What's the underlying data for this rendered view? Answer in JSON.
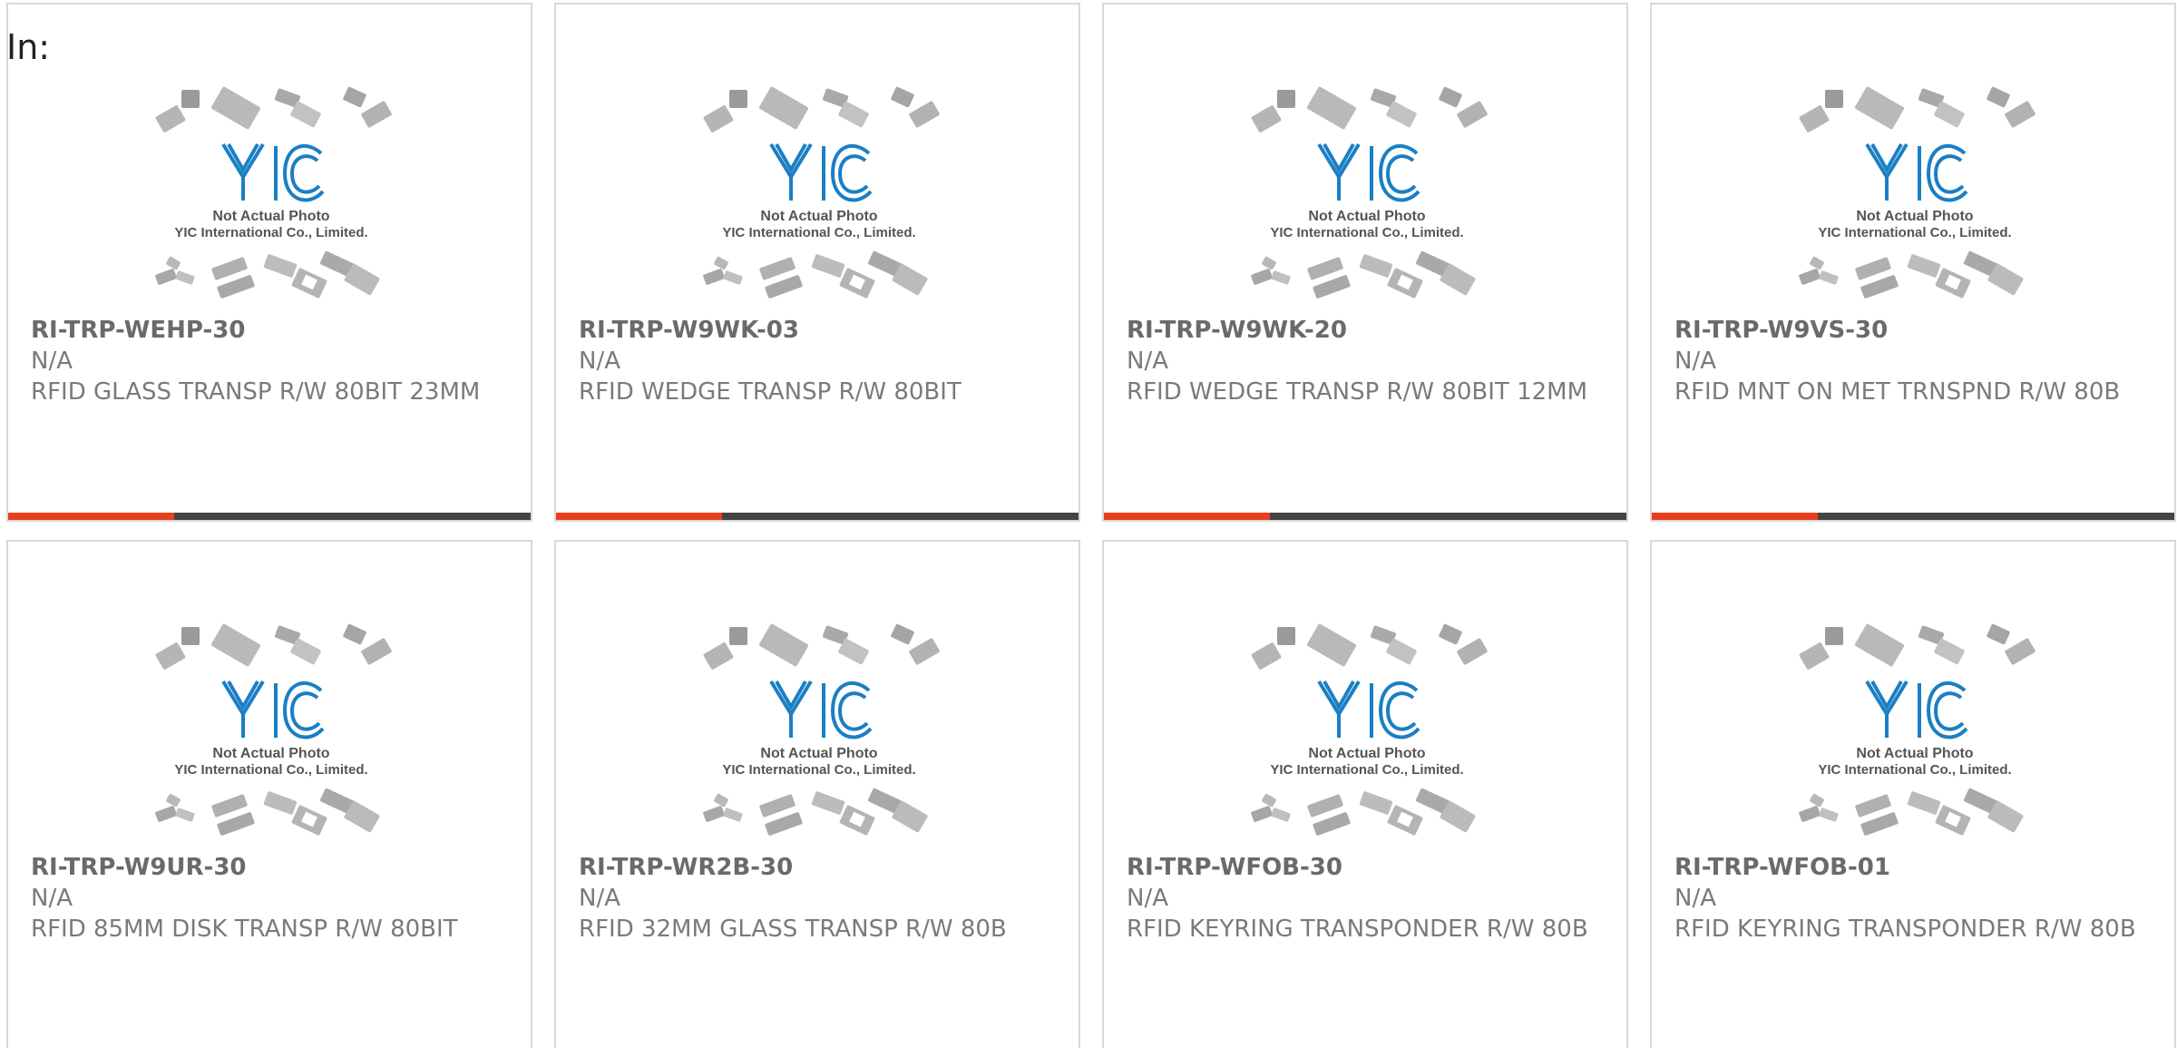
{
  "header": {
    "label": "In:"
  },
  "colors": {
    "accent": "#e8401c",
    "bar": "#444444",
    "logo_blue": "#1a7fc4"
  },
  "placeholder_image": {
    "icon": "chip-package-icon",
    "caption_line1": "Not Actual Photo",
    "caption_line2": "YIC International Co., Limited."
  },
  "products": [
    {
      "part": "RI-TRP-WEHP-30",
      "mfr": "N/A",
      "desc": "RFID GLASS TRANSP R/W 80BIT 23MM"
    },
    {
      "part": "RI-TRP-W9WK-03",
      "mfr": "N/A",
      "desc": "RFID WEDGE TRANSP R/W 80BIT"
    },
    {
      "part": "RI-TRP-W9WK-20",
      "mfr": "N/A",
      "desc": "RFID WEDGE TRANSP R/W 80BIT 12MM"
    },
    {
      "part": "RI-TRP-W9VS-30",
      "mfr": "N/A",
      "desc": "RFID MNT ON MET TRNSPND R/W 80B"
    },
    {
      "part": "RI-TRP-W9UR-30",
      "mfr": "N/A",
      "desc": "RFID 85MM DISK TRANSP R/W 80BIT"
    },
    {
      "part": "RI-TRP-WR2B-30",
      "mfr": "N/A",
      "desc": "RFID 32MM GLASS TRANSP R/W 80B"
    },
    {
      "part": "RI-TRP-WFOB-30",
      "mfr": "N/A",
      "desc": "RFID KEYRING TRANSPONDER R/W 80B"
    },
    {
      "part": "RI-TRP-WFOB-01",
      "mfr": "N/A",
      "desc": "RFID KEYRING TRANSPONDER R/W 80B"
    }
  ]
}
